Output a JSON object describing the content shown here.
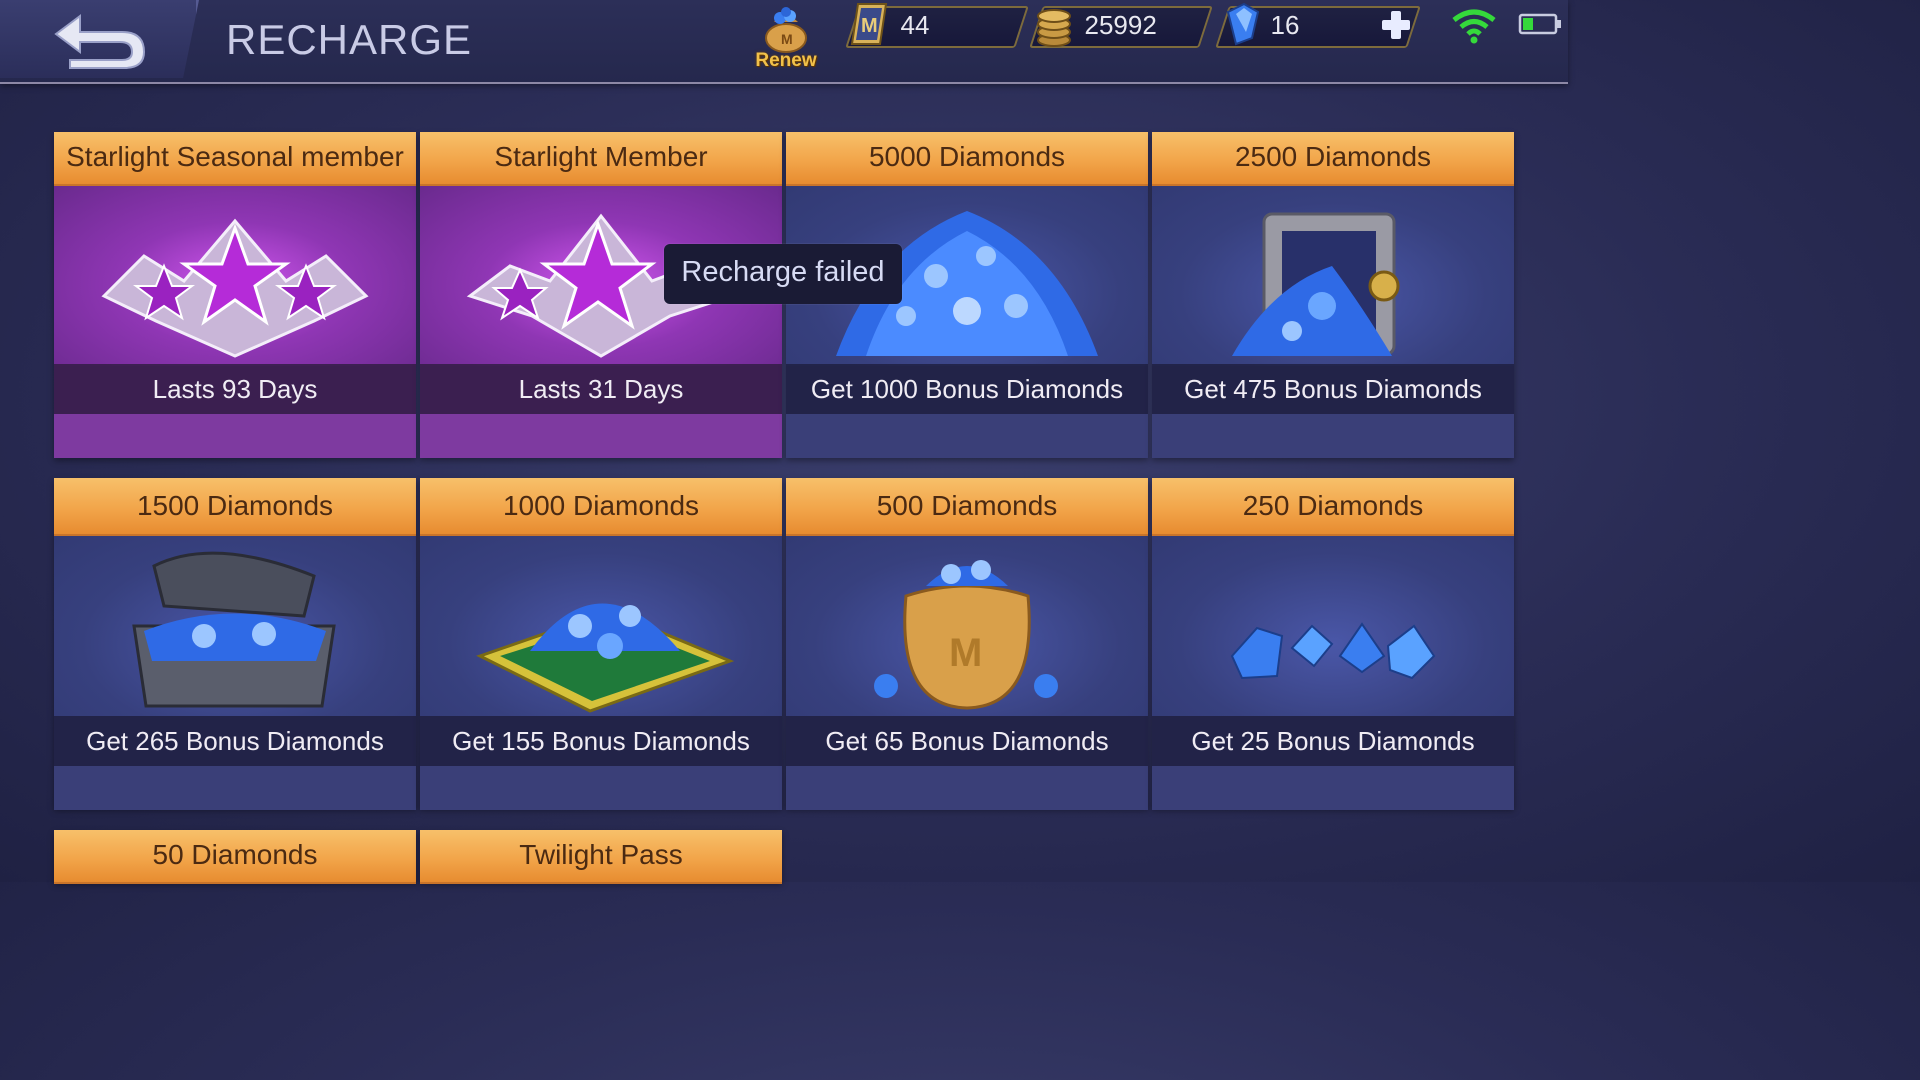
{
  "header": {
    "title": "RECHARGE",
    "renew_label": "Renew"
  },
  "currencies": {
    "tickets": "44",
    "battle_points": "25992",
    "diamonds": "16"
  },
  "toast": "Recharge failed",
  "colors": {
    "header_bar": "#f2a54a",
    "card_blue": "#353a72",
    "card_purple": "#6e2f8c",
    "renew_text": "#f2c14a",
    "wifi": "#35d93b",
    "battery": "#35d93b"
  },
  "cards": [
    {
      "title": "Starlight Seasonal member",
      "caption": "Lasts 93 Days",
      "art": "starlight-badge-icon"
    },
    {
      "title": "Starlight Member",
      "caption": "Lasts 31 Days",
      "art": "starlight-badge-icon"
    },
    {
      "title": "5000 Diamonds",
      "caption": "Get 1000 Bonus Diamonds",
      "art": "diamond-pile-icon"
    },
    {
      "title": "2500 Diamonds",
      "caption": "Get 475 Bonus Diamonds",
      "art": "diamond-safe-icon"
    },
    {
      "title": "1500 Diamonds",
      "caption": "Get 265 Bonus Diamonds",
      "art": "diamond-chest-icon"
    },
    {
      "title": "1000 Diamonds",
      "caption": "Get 155 Bonus Diamonds",
      "art": "diamond-cushion-icon"
    },
    {
      "title": "500 Diamonds",
      "caption": "Get 65 Bonus Diamonds",
      "art": "diamond-bag-icon"
    },
    {
      "title": "250 Diamonds",
      "caption": "Get 25 Bonus Diamonds",
      "art": "diamonds-small-icon"
    },
    {
      "title": "50 Diamonds",
      "caption": "",
      "art": ""
    },
    {
      "title": "Twilight Pass",
      "caption": "",
      "art": ""
    }
  ]
}
